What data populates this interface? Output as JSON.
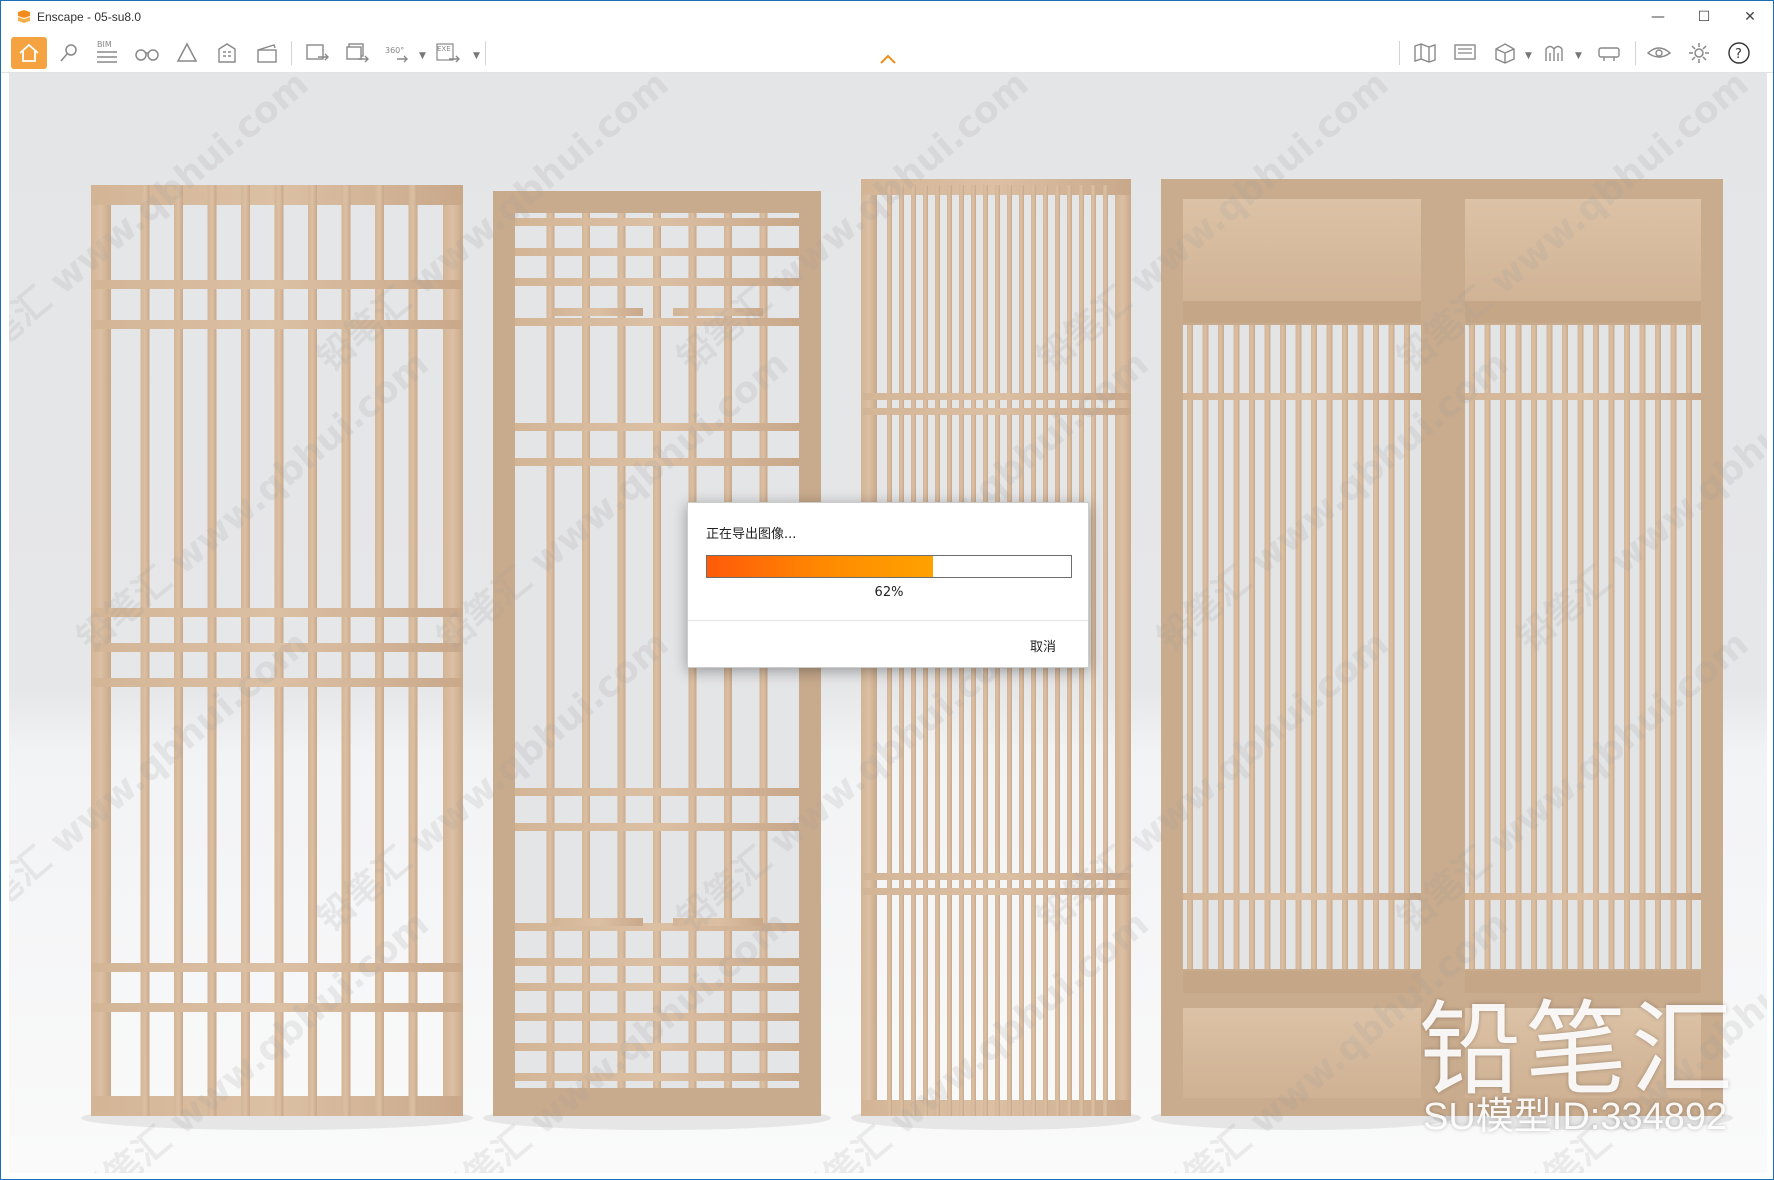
{
  "window": {
    "title": "Enscape - 05-su8.0",
    "controls": {
      "minimize": "—",
      "maximize": "☐",
      "close": "✕"
    }
  },
  "toolbar": {
    "left_icons": [
      "home-icon",
      "location-icon",
      "bim-icon",
      "binoculars-icon",
      "alert-icon",
      "building-icon",
      "clapperboard-icon",
      "screenshot-export-icon",
      "batch-export-icon",
      "panorama-360-icon",
      "exe-export-icon"
    ],
    "bim_label": "BIM",
    "panorama_label": "360°",
    "exe_label": "EXE",
    "right_icons": [
      "map-icon",
      "monitor-icon",
      "cube-icon",
      "asset-library-icon",
      "vr-headset-icon",
      "eye-icon",
      "settings-icon",
      "help-icon"
    ],
    "help_label": "?",
    "accent": "#f4a340"
  },
  "dialog": {
    "title": "正在导出图像...",
    "progress": 0.62,
    "percent_label": "62%",
    "cancel_label": "取消",
    "bar_colors": [
      "#ff5a0a",
      "#ffa200"
    ]
  },
  "overlay": {
    "brand_text": "铅笔汇",
    "model_id": "SU模型ID:334892",
    "watermark_text": "铅笔汇 www.qbhui.com"
  }
}
